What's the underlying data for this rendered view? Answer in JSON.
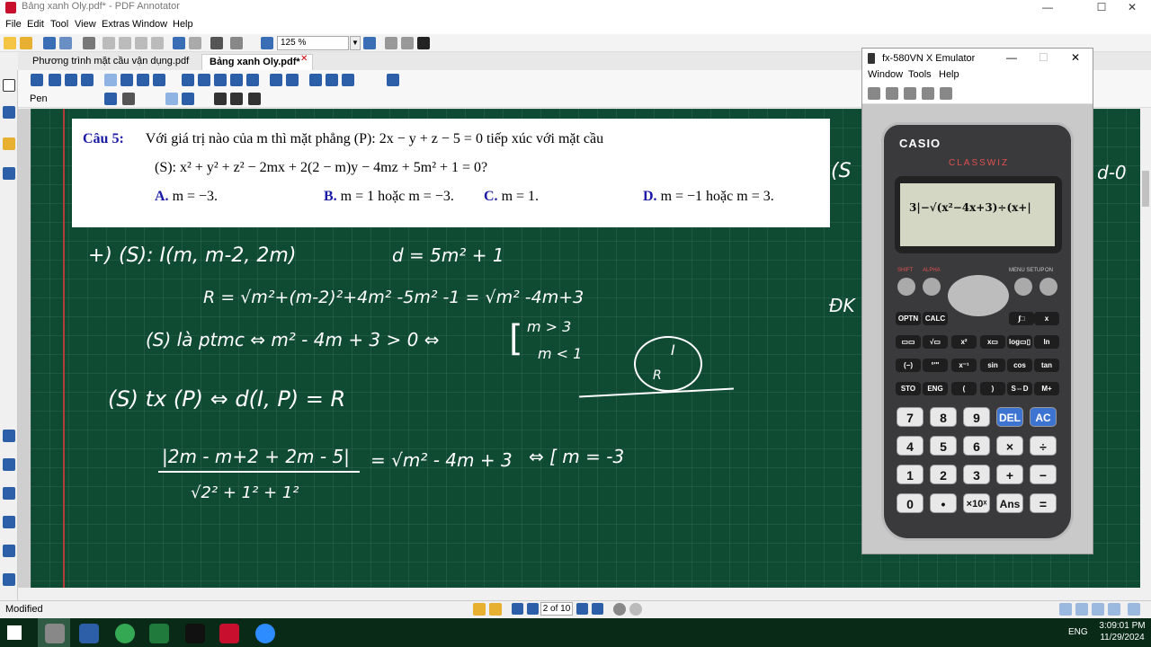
{
  "window": {
    "title": "Bảng xanh Oly.pdf* - PDF Annotator"
  },
  "menu": [
    "File",
    "Edit",
    "Tool",
    "View",
    "Extras",
    "Window",
    "Help"
  ],
  "toolbar": {
    "zoom": "125 %",
    "pen_label": "Pen"
  },
  "tabs": [
    {
      "label": "Phương trình mặt cầu vận dụng.pdf"
    },
    {
      "label": "Bảng xanh Oly.pdf*"
    }
  ],
  "question": {
    "label": "Câu 5:",
    "line1": "Với giá trị nào của m thì mặt phẳng (P): 2x − y + z − 5 = 0 tiếp xúc với mặt cầu",
    "line2": "(S): x² + y² + z² − 2mx + 2(2 − m)y − 4mz + 5m² + 1 = 0?",
    "answers": [
      {
        "key": "A.",
        "text": "m = −3."
      },
      {
        "key": "B.",
        "text": "m = 1 hoặc m = −3."
      },
      {
        "key": "C.",
        "text": "m = 1."
      },
      {
        "key": "D.",
        "text": "m = −1 hoặc m = 3."
      }
    ]
  },
  "handwriting": {
    "l1a": "+) (S): I(m, m-2, 2m)",
    "l1b": "d = 5m² + 1",
    "l2": "R = √m²+(m-2)²+4m² -5m² -1 = √m² -4m+3",
    "l3a": "(S) là ptmc ⇔ m² - 4m + 3 > 0 ⇔",
    "l3b": "m > 3",
    "l3c": "m < 1",
    "l4": "(S) tx (P) ⇔ d(I, P) = R",
    "l5num": "|2m - m+2 + 2m - 5|",
    "l5den": "√2² + 1² + 1²",
    "l5rhs": "= √m² - 4m + 3",
    "l5res": "⇔ [ m = -3",
    "circI": "I",
    "circR": "R",
    "right1": "(S",
    "right2": "d-0",
    "right3": "ĐK"
  },
  "status": {
    "modified": "Modified",
    "page": "2 of 10"
  },
  "clock": {
    "time": "3:09:01 PM",
    "date": "11/29/2024",
    "lang": "ENG"
  },
  "calc": {
    "title": "fx-580VN X Emulator",
    "menu": [
      "Window",
      "Tools",
      "Help"
    ],
    "brand": "CASIO",
    "model": "CLASSWIZ",
    "lcd": "3|−√(x²−4x+3)÷(x+|",
    "keys_fn": [
      "OPTN",
      "CALC",
      "∫□",
      "x",
      "▭▭",
      "√▭",
      "x²",
      "x▭",
      "log▭▯",
      "ln",
      "(−)",
      "°'\"",
      "x⁻¹",
      "sin",
      "cos",
      "tan",
      "STO",
      "ENG",
      "(",
      ")",
      "S⇔D",
      "M+"
    ],
    "keys_num": [
      "7",
      "8",
      "9",
      "DEL",
      "AC",
      "4",
      "5",
      "6",
      "×",
      "÷",
      "1",
      "2",
      "3",
      "+",
      "−",
      "0",
      "•",
      "×10ˣ",
      "Ans",
      "="
    ],
    "labels_top": [
      "SHIFT",
      "ALPHA",
      "MENU SETUP",
      "ON"
    ]
  },
  "colors": {
    "board": "#0f4a32",
    "accent_blue": "#1a1aa6",
    "calc_blue_key": "#3d74d1"
  }
}
